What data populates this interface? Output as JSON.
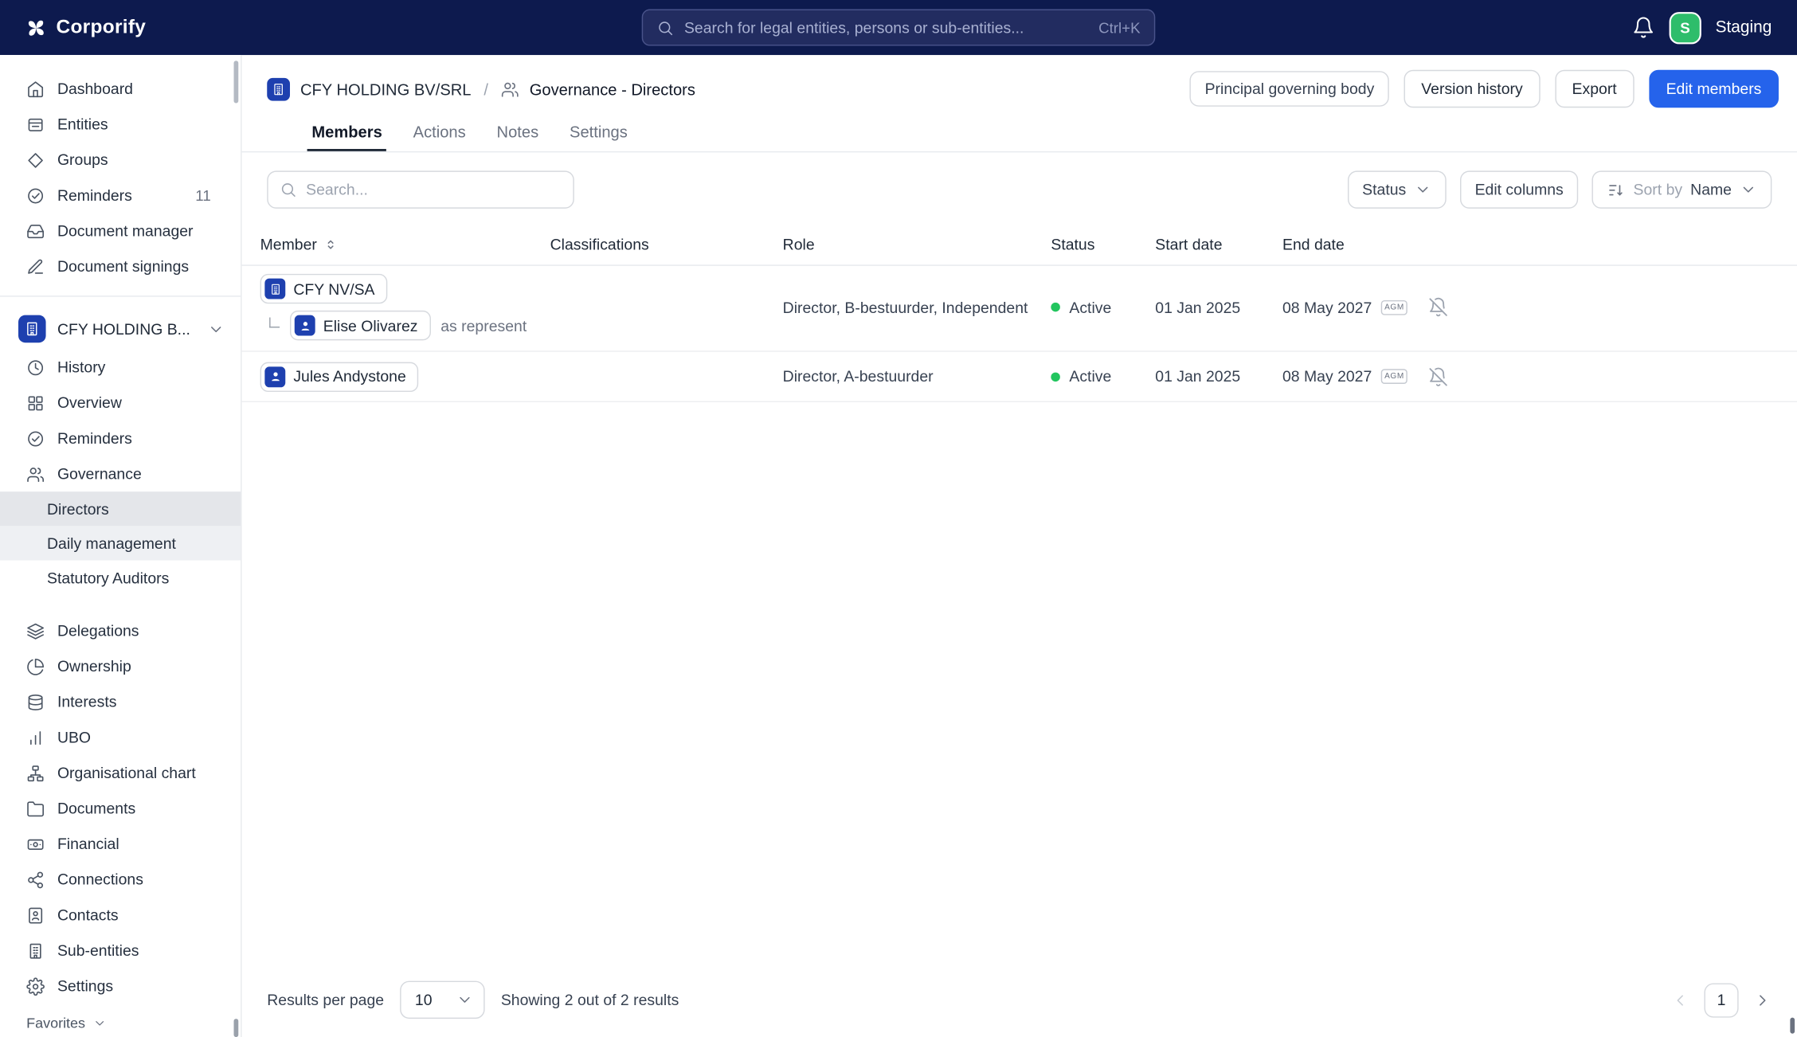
{
  "topbar": {
    "brand": "Corporify",
    "search": {
      "placeholder": "Search for legal entities, persons or sub-entities...",
      "shortcut": "Ctrl+K"
    },
    "avatar_initial": "S",
    "environment": "Staging"
  },
  "sidebar": {
    "global_items": [
      {
        "label": "Dashboard",
        "icon": "home"
      },
      {
        "label": "Entities",
        "icon": "entities"
      },
      {
        "label": "Groups",
        "icon": "groups"
      },
      {
        "label": "Reminders",
        "icon": "check-circle",
        "badge": "11"
      },
      {
        "label": "Document manager",
        "icon": "inbox"
      },
      {
        "label": "Document signings",
        "icon": "pen"
      }
    ],
    "entity": {
      "label": "CFY HOLDING B..."
    },
    "entity_items": [
      {
        "label": "History",
        "icon": "clock"
      },
      {
        "label": "Overview",
        "icon": "grid"
      },
      {
        "label": "Reminders",
        "icon": "check-circle"
      },
      {
        "label": "Governance",
        "icon": "users"
      }
    ],
    "governance_children": [
      {
        "label": "Directors",
        "active": true
      },
      {
        "label": "Daily management"
      },
      {
        "label": "Statutory Auditors"
      }
    ],
    "lower_items": [
      {
        "label": "Delegations",
        "icon": "layers"
      },
      {
        "label": "Ownership",
        "icon": "pie"
      },
      {
        "label": "Interests",
        "icon": "database"
      },
      {
        "label": "UBO",
        "icon": "bar-chart"
      },
      {
        "label": "Organisational chart",
        "icon": "org-chart"
      },
      {
        "label": "Documents",
        "icon": "folder"
      },
      {
        "label": "Financial",
        "icon": "banknote"
      },
      {
        "label": "Connections",
        "icon": "share"
      },
      {
        "label": "Contacts",
        "icon": "contact-card"
      },
      {
        "label": "Sub-entities",
        "icon": "building"
      },
      {
        "label": "Settings",
        "icon": "gear"
      }
    ],
    "favorites_label": "Favorites"
  },
  "header": {
    "breadcrumb": {
      "entity": "CFY HOLDING BV/SRL",
      "separator": "/",
      "page": "Governance - Directors"
    },
    "tag": "Principal governing body",
    "version_history": "Version history",
    "export": "Export",
    "edit_members": "Edit members"
  },
  "tabs": [
    {
      "label": "Members",
      "active": true
    },
    {
      "label": "Actions"
    },
    {
      "label": "Notes"
    },
    {
      "label": "Settings"
    }
  ],
  "toolbar": {
    "search_placeholder": "Search...",
    "status": "Status",
    "edit_columns": "Edit columns",
    "sort_by": "Sort by",
    "sort_value": "Name"
  },
  "table": {
    "columns": [
      "Member",
      "Classifications",
      "Role",
      "Status",
      "Start date",
      "End date"
    ],
    "rows": [
      {
        "member": "CFY NV/SA",
        "member_type": "entity",
        "nested_member": "Elise Olivarez",
        "nested_note": "as represent",
        "classifications": "",
        "role": "Director, B-bestuurder, Independent",
        "status": "Active",
        "start_date": "01 Jan 2025",
        "end_date": "08 May 2027",
        "end_badge": "AGM"
      },
      {
        "member": "Jules Andystone",
        "member_type": "person",
        "classifications": "",
        "role": "Director, A-bestuurder",
        "status": "Active",
        "start_date": "01 Jan 2025",
        "end_date": "08 May 2027",
        "end_badge": "AGM"
      }
    ]
  },
  "footer": {
    "results_per_page_label": "Results per page",
    "page_size": "10",
    "summary": "Showing 2 out of 2 results",
    "page": "1"
  },
  "colors": {
    "topbar_bg": "#0d1a4e",
    "primary_blue": "#2563eb",
    "entity_icon_blue": "#1e40af",
    "status_green": "#22c55e",
    "avatar_green": "#2ebd6b"
  }
}
